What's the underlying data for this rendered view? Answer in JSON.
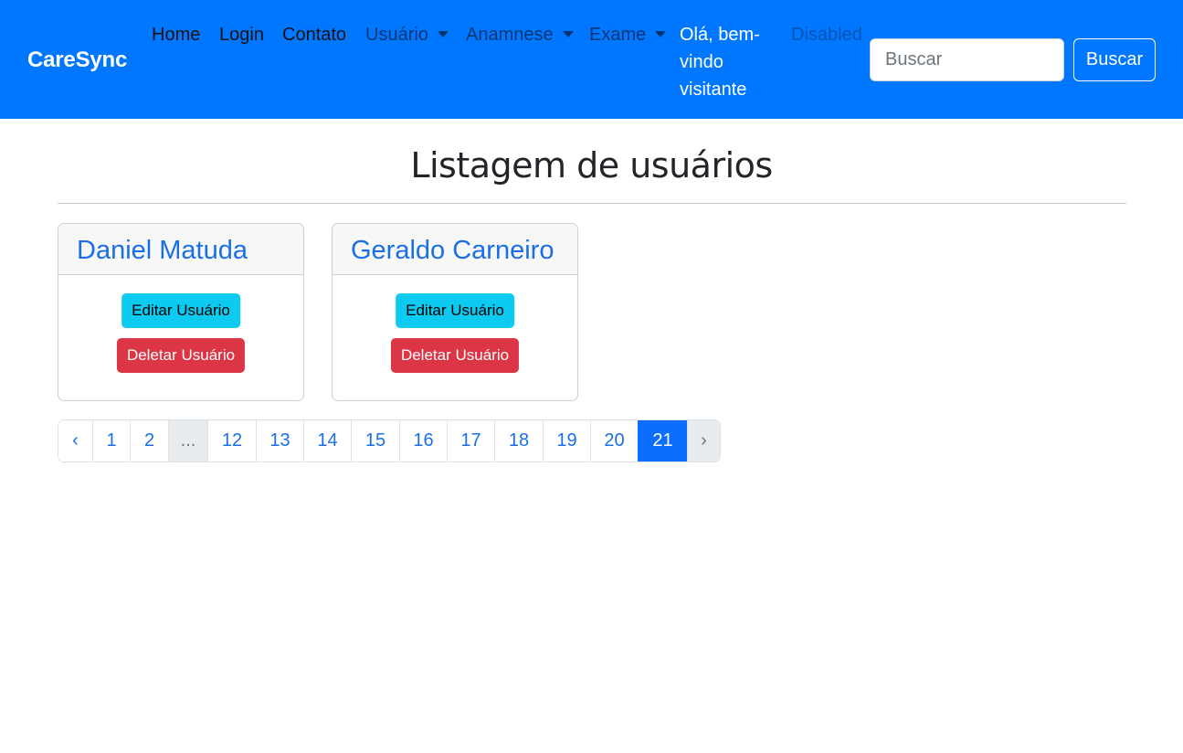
{
  "navbar": {
    "brand": "CareSync",
    "links": {
      "home": "Home",
      "login": "Login",
      "contato": "Contato",
      "usuario": "Usuário",
      "anamnese": "Anamnese",
      "exame": "Exame",
      "greeting": "Olá, bem-vindo visitante",
      "disabled": "Disabled"
    },
    "search": {
      "placeholder": "Buscar",
      "value": "",
      "button_label": "Buscar"
    }
  },
  "main": {
    "title": "Listagem de usuários",
    "users": [
      {
        "name": "Daniel Matuda",
        "edit_label": "Editar Usuário",
        "delete_label": "Deletar Usuário"
      },
      {
        "name": "Geraldo Carneiro",
        "edit_label": "Editar Usuário",
        "delete_label": "Deletar Usuário"
      }
    ]
  },
  "pagination": {
    "prev": "‹",
    "pages": [
      "1",
      "2",
      "...",
      "12",
      "13",
      "14",
      "15",
      "16",
      "17",
      "18",
      "19",
      "20",
      "21"
    ],
    "current": "21",
    "next": "›"
  },
  "colors": {
    "navbar_bg": "#0077ff",
    "link_primary": "#1a6fe8",
    "info_button": "#0dcaf0",
    "danger_button": "#dc3545",
    "active_page": "#0d6efd"
  }
}
